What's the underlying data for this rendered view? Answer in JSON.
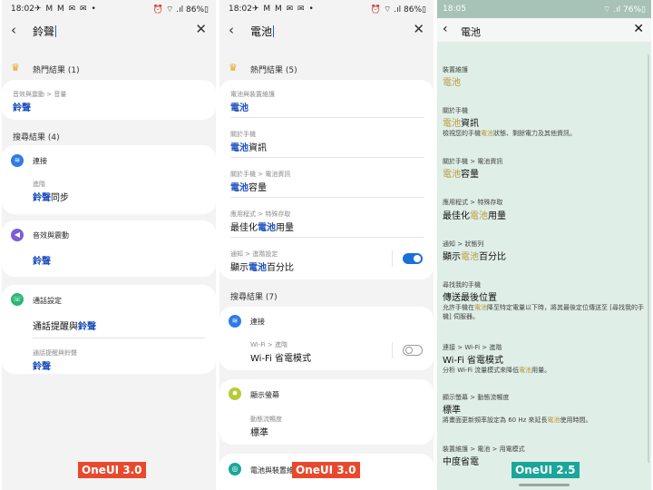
{
  "panel1": {
    "status": {
      "time": "18:02",
      "icons": "✈ M M ✉ ✉ •",
      "right": "⏰ ⌔ .ıl 86%▯"
    },
    "query": "鈴聲",
    "top_header": "熱門結果 (1)",
    "top": {
      "path": "音效與震動 > 音量",
      "value": "鈴聲"
    },
    "search_header": "搜尋結果 (4)",
    "cat1": {
      "label": "連接",
      "icon": "wifi-icon"
    },
    "cat1_item": {
      "path": "進階",
      "value_hl": "鈴聲",
      "value_rest": "同步"
    },
    "cat2": {
      "label": "音效與震動",
      "icon": "speaker-icon"
    },
    "cat2_item": {
      "value": "鈴聲"
    },
    "cat3": {
      "label": "通話設定",
      "icon": "phone-icon"
    },
    "cat3_item1": {
      "value_pre": "通話提醒與",
      "value_hl": "鈴聲"
    },
    "cat3_item2": {
      "path": "通話提醒與鈴聲",
      "value": "鈴聲"
    },
    "badge": "OneUI 3.0"
  },
  "panel2": {
    "status": {
      "time": "18:02",
      "icons": "✈ M M ✉ ✉ •",
      "right": "⏰ ⌔ .ıl 86%▯"
    },
    "query": "電池",
    "top_header": "熱門結果 (5)",
    "top_items": [
      {
        "path": "電池與裝置維護",
        "hl": "電池",
        "rest": "",
        "pre": ""
      },
      {
        "path": "關於手機",
        "hl": "電池",
        "rest": "資訊",
        "pre": ""
      },
      {
        "path": "關於手機 > 電池資訊",
        "hl": "電池",
        "rest": "容量",
        "pre": ""
      },
      {
        "path": "應用程式 > 特殊存取",
        "hl": "電池",
        "rest": "用量",
        "pre": "最佳化"
      },
      {
        "path": "通知 > 進階設定",
        "hl": "電池",
        "rest": "百分比",
        "pre": "顯示"
      }
    ],
    "toggle_on": true,
    "search_header": "搜尋結果 (7)",
    "cat1": {
      "label": "連接"
    },
    "cat1_item": {
      "path": "Wi-Fi > 進階",
      "value": "Wi-Fi 省電模式"
    },
    "toggle_off": false,
    "cat2": {
      "label": "顯示螢幕"
    },
    "cat2_item": {
      "path": "動態流暢度",
      "value": "標準"
    },
    "cat3": {
      "label": "電池與裝置維"
    },
    "badge": "OneUI 3.0"
  },
  "panel3": {
    "status": {
      "time": "18:05",
      "right": "⌔ .ıl 76%▯"
    },
    "query": "電池",
    "items": [
      {
        "path": "裝置維護",
        "pre": "",
        "hl": "電池",
        "rest": ""
      },
      {
        "path": "關於手機",
        "pre": "",
        "hl": "電池",
        "rest": "資訊",
        "sum_pre": "檢視您的手機",
        "sum_hl": "電池",
        "sum_rest": "狀態、剩餘電力及其他資訊。"
      },
      {
        "path": "關於手機 > 電池資訊",
        "pre": "",
        "hl": "電池",
        "rest": "容量"
      },
      {
        "path": "應用程式 > 特殊存取",
        "pre": "最佳化",
        "hl": "電池",
        "rest": "用量"
      },
      {
        "path": "通知 > 狀態列",
        "pre": "顯示",
        "hl": "電池",
        "rest": "百分比"
      },
      {
        "path": "尋找我的手機",
        "value": "傳送最後位置",
        "sum_pre": "允許手機在",
        "sum_hl": "電池",
        "sum_rest": "降至特定電量以下時，將其最後定位傳送至 [尋找我的手機] 伺服器。"
      },
      {
        "path": "連接 > Wi-Fi > 進階",
        "value": "Wi-Fi 省電模式",
        "sum_pre": "分析 Wi-Fi 流量模式來降低",
        "sum_hl": "電池",
        "sum_rest": "用量。"
      },
      {
        "path": "顯示螢幕 > 動態流暢度",
        "value": "標準",
        "sum_pre": "將畫面更新頻率設定為 60 Hz 來延長",
        "sum_hl": "電池",
        "sum_rest": "使用時間。"
      },
      {
        "path": "裝置維護 > 電池 > 用電模式",
        "value": "中度省電"
      }
    ],
    "badge": "OneUI 2.5"
  }
}
